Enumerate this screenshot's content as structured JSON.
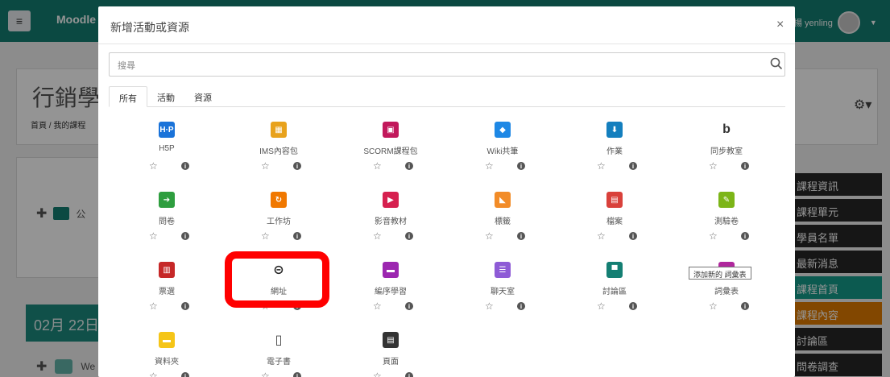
{
  "background": {
    "brand": "Moodle",
    "user_name": "楊 yenling",
    "course_title": "行銷學",
    "breadcrumb": "首頁 / 我的課程",
    "forum_label": "公",
    "date_bar": "02月 22日",
    "bottom_label": "We",
    "side_menu": [
      "課程資訊",
      "課程單元",
      "學員名單",
      "最新消息",
      "課程首頁",
      "課程內容",
      "討論區",
      "問卷調查"
    ]
  },
  "modal": {
    "title": "新增活動或資源",
    "close_label": "×",
    "search_placeholder": "搜尋",
    "tabs": [
      "所有",
      "活動",
      "資源"
    ]
  },
  "tiles": [
    {
      "label": "H5P",
      "icon": "h5p-icon",
      "color": "#1a73d9"
    },
    {
      "label": "IMS內容包",
      "icon": "ims-package-icon",
      "color": "#e8a21c"
    },
    {
      "label": "SCORM課程包",
      "icon": "scorm-icon",
      "color": "#c2185b"
    },
    {
      "label": "Wiki共筆",
      "icon": "wiki-icon",
      "color": "#1e88e5"
    },
    {
      "label": "作業",
      "icon": "assignment-icon",
      "color": "#147fbe"
    },
    {
      "label": "同步教室",
      "icon": "bigbluebutton-icon",
      "color": "#333333"
    },
    {
      "label": "問卷",
      "icon": "feedback-icon",
      "color": "#2e9e3f"
    },
    {
      "label": "工作坊",
      "icon": "workshop-icon",
      "color": "#f07800"
    },
    {
      "label": "影音教材",
      "icon": "video-icon",
      "color": "#d6204f"
    },
    {
      "label": "標籤",
      "icon": "label-icon",
      "color": "#f28c28"
    },
    {
      "label": "檔案",
      "icon": "file-icon",
      "color": "#d9413b"
    },
    {
      "label": "測驗卷",
      "icon": "quiz-icon",
      "color": "#7cb518"
    },
    {
      "label": "票選",
      "icon": "choice-icon",
      "color": "#c62828"
    },
    {
      "label": "網址",
      "icon": "url-icon",
      "color": "#222222"
    },
    {
      "label": "編序學習",
      "icon": "lesson-icon",
      "color": "#9c27b0"
    },
    {
      "label": "聊天室",
      "icon": "chat-icon",
      "color": "#8e5bd6"
    },
    {
      "label": "討論區",
      "icon": "forum-icon",
      "color": "#147f73"
    },
    {
      "label": "詞彙表",
      "icon": "glossary-icon",
      "color": "#b0279d"
    },
    {
      "label": "資料夾",
      "icon": "folder-icon",
      "color": "#f5c518"
    },
    {
      "label": "電子書",
      "icon": "book-icon",
      "color": "#444444"
    },
    {
      "label": "頁面",
      "icon": "page-icon",
      "color": "#333333"
    }
  ],
  "tooltip": "添加新的 詞彙表"
}
